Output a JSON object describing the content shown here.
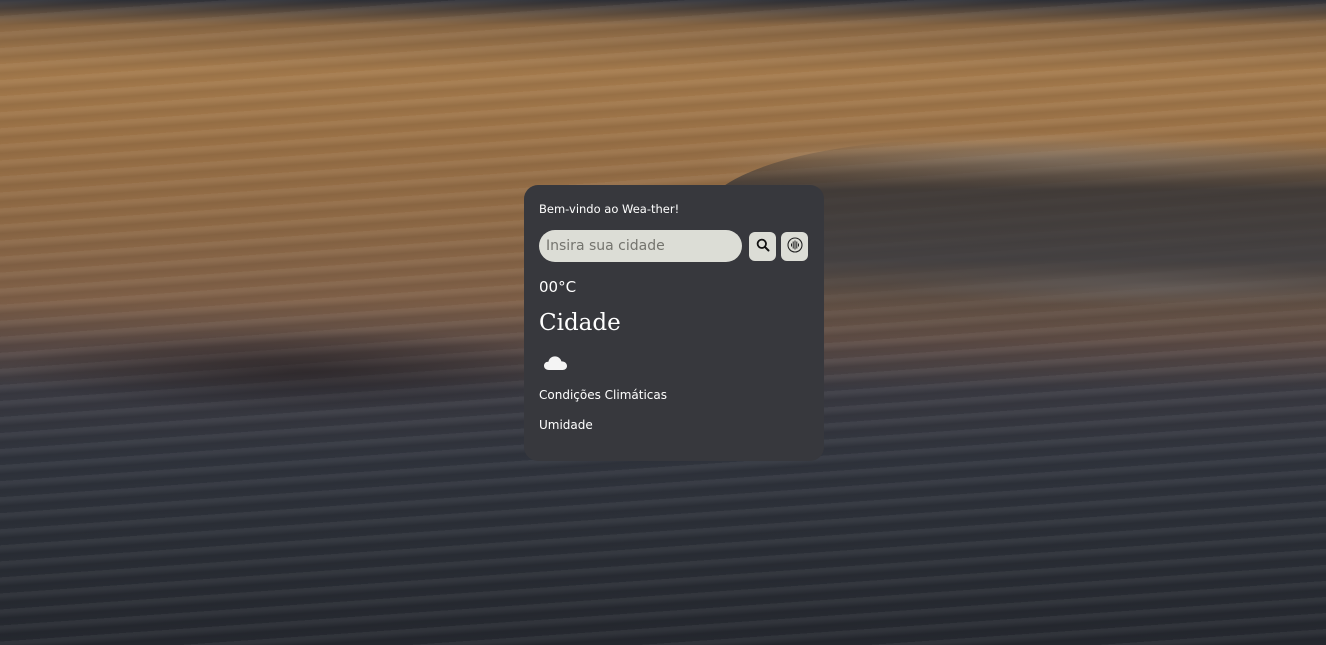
{
  "app": {
    "welcome": "Bem-vindo ao Wea-ther!"
  },
  "search": {
    "placeholder": "Insira sua cidade",
    "value": "",
    "search_icon": "magnifier-icon",
    "voice_icon": "voice-waveform-icon"
  },
  "weather": {
    "temperature": "00°C",
    "city": "Cidade",
    "icon": "cloud-icon",
    "conditions": "Condições Climáticas",
    "humidity": "Umidade"
  },
  "colors": {
    "card_background": "#37383d",
    "input_background": "#dcddd6",
    "text": "#ffffff"
  }
}
